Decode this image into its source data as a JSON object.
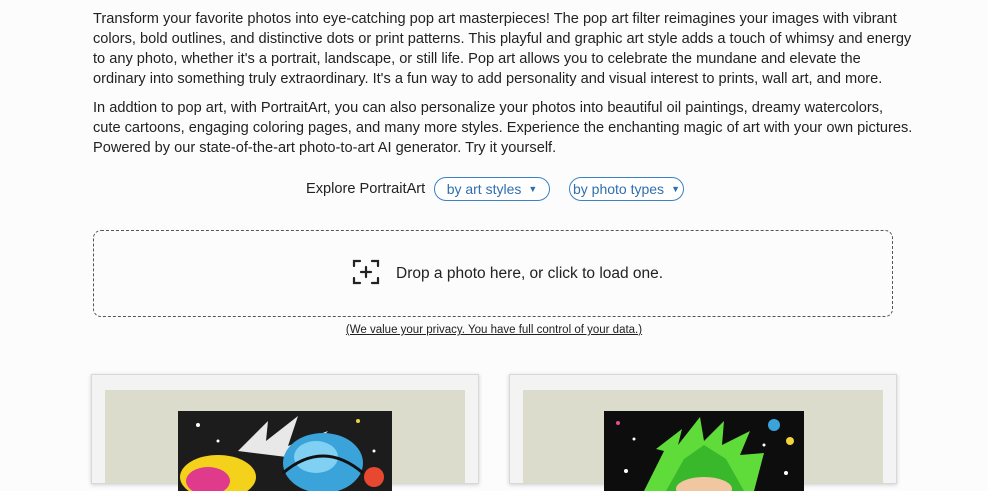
{
  "intro": {
    "paragraph1": "Transform your favorite photos into eye-catching pop art masterpieces! The pop art filter reimagines your images with vibrant colors, bold outlines, and distinctive dots or print patterns. This playful and graphic art style adds a touch of whimsy and energy to any photo, whether it's a portrait, landscape, or still life. Pop art allows you to celebrate the mundane and elevate the ordinary into something truly extraordinary. It's a fun way to add personality and visual interest to prints, wall art, and more.",
    "paragraph2": "In addtion to pop art, with PortraitArt, you can also personalize your photos into beautiful oil paintings, dreamy watercolors, cute cartoons, engaging coloring pages, and many more styles. Experience the enchanting magic of art with your own pictures. Powered by our state-of-the-art photo-to-art AI generator. Try it yourself."
  },
  "explore": {
    "label": "Explore PortraitArt",
    "art_styles": "by art styles",
    "photo_types": "by photo types"
  },
  "upload": {
    "icon": "add-photo-icon",
    "prompt": "Drop a photo here, or click to load one.",
    "privacy": "(We value your privacy. You have full control of your data.)"
  },
  "gallery": {
    "items": [
      {
        "icon": "pop-art-boxer-image"
      },
      {
        "icon": "pop-art-green-hair-image"
      }
    ]
  },
  "colors": {
    "accent": "#3b82c4",
    "background": "#fcfcfc",
    "mat": "#dcdccc"
  }
}
